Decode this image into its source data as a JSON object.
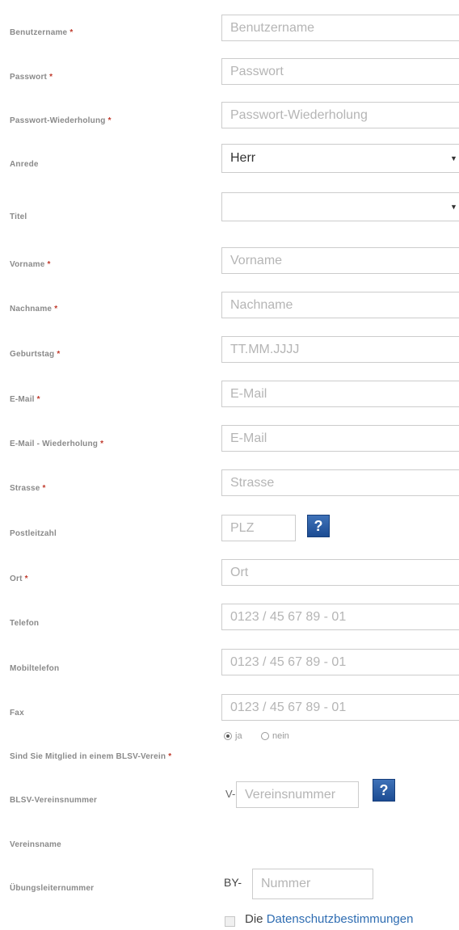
{
  "required_marker": "*",
  "fields": {
    "username": {
      "label": "Benutzername",
      "placeholder": "Benutzername"
    },
    "password": {
      "label": "Passwort",
      "placeholder": "Passwort"
    },
    "password_repeat": {
      "label": "Passwort-Wiederholung",
      "placeholder": "Passwort-Wiederholung"
    },
    "salutation": {
      "label": "Anrede",
      "value": "Herr"
    },
    "title": {
      "label": "Titel",
      "value": ""
    },
    "firstname": {
      "label": "Vorname",
      "placeholder": "Vorname"
    },
    "lastname": {
      "label": "Nachname",
      "placeholder": "Nachname"
    },
    "birthday": {
      "label": "Geburtstag",
      "placeholder": "TT.MM.JJJJ"
    },
    "email": {
      "label": "E-Mail",
      "placeholder": "E-Mail"
    },
    "email_repeat": {
      "label": "E-Mail - Wiederholung",
      "placeholder": "E-Mail"
    },
    "street": {
      "label": "Strasse",
      "placeholder": "Strasse"
    },
    "zip": {
      "label": "Postleitzahl",
      "placeholder": "PLZ"
    },
    "city": {
      "label": "Ort",
      "placeholder": "Ort"
    },
    "phone": {
      "label": "Telefon",
      "placeholder": "0123 / 45 67 89 - 01"
    },
    "mobile": {
      "label": "Mobiltelefon",
      "placeholder": "0123 / 45 67 89 - 01"
    },
    "fax": {
      "label": "Fax",
      "placeholder": "0123 / 45 67 89 - 01"
    },
    "membership": {
      "label": "Sind Sie Mitglied in einem BLSV-Verein",
      "option_yes": "ja",
      "option_no": "nein",
      "selected": "ja"
    },
    "club_number": {
      "label": "BLSV-Vereinsnummer",
      "prefix": "V-",
      "placeholder": "Vereinsnummer"
    },
    "club_name": {
      "label": "Vereinsname"
    },
    "trainer_number": {
      "label": "Übungsleiternummer",
      "prefix": "BY-",
      "placeholder": "Nummer"
    }
  },
  "help_button": "?",
  "consent": {
    "prefix": "Die",
    "link": "Datenschutzbestimmungen"
  },
  "colors": {
    "required": "#c0392b",
    "help_button": "#2a5ea5",
    "link": "#2f6db2"
  }
}
